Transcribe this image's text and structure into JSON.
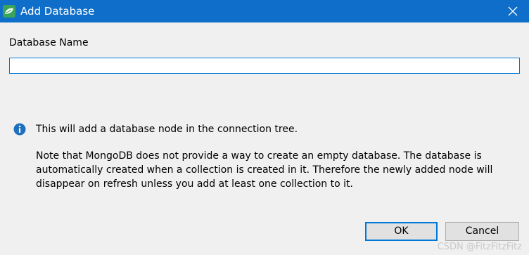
{
  "window": {
    "title": "Add Database",
    "app_icon": "mongo-leaf-icon",
    "close_icon": "close-icon"
  },
  "form": {
    "name_label": "Database Name",
    "name_value": "",
    "name_placeholder": ""
  },
  "info": {
    "icon": "info-icon",
    "headline": "This will add a database node in the connection tree.",
    "note_lines": [
      "Note that MongoDB does not provide a way to create an empty database. The database is",
      "automatically created when a collection is created in it. Therefore the newly added node will",
      "disappear on refresh unless you add at least one collection to it."
    ]
  },
  "buttons": {
    "ok_label": "OK",
    "cancel_label": "Cancel"
  },
  "watermark": "CSDN @FitzFitzFitz",
  "colors": {
    "titlebar": "#0f6ec9",
    "accent": "#0078d7",
    "dialog_bg": "#f0f0f0",
    "info_icon": "#1f6fbf"
  }
}
